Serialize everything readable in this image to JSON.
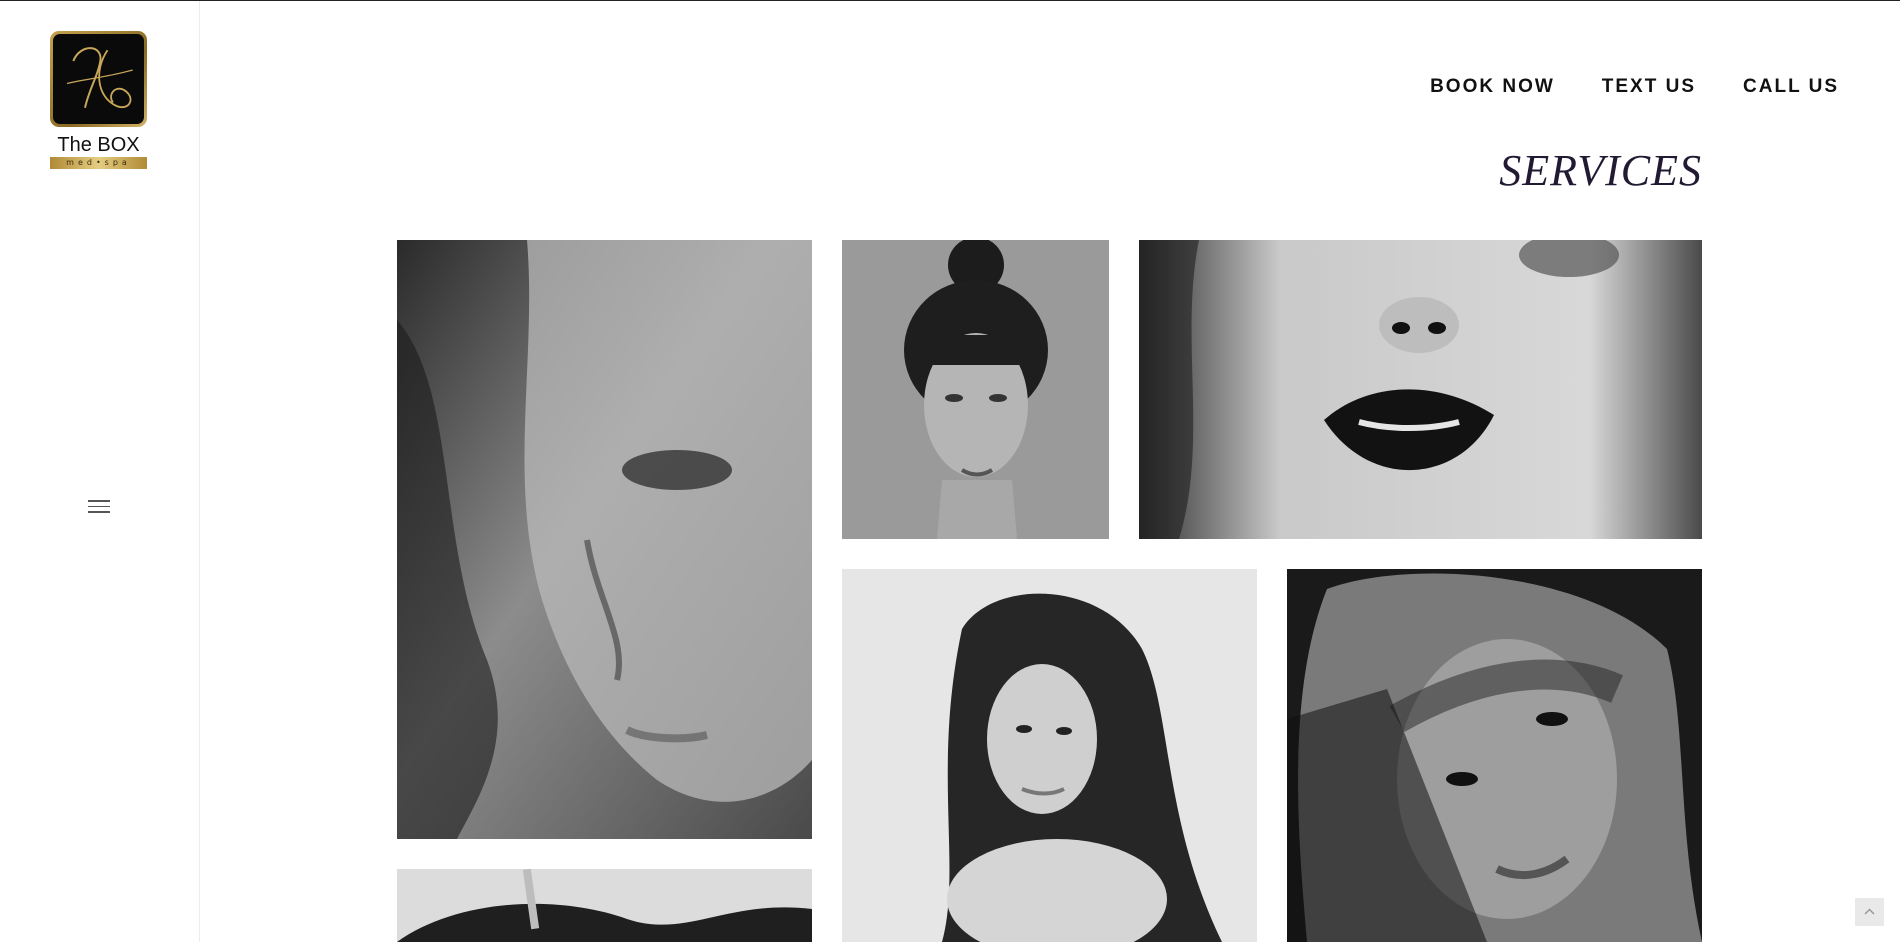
{
  "brand": {
    "name": "The BOX",
    "tagline": "med•spa",
    "accent_color": "#c6a24f"
  },
  "nav": {
    "items": [
      {
        "label": "BOOK NOW"
      },
      {
        "label": "TEXT US"
      },
      {
        "label": "CALL US"
      }
    ]
  },
  "page": {
    "title": "SERVICES"
  },
  "gallery": {
    "tiles": [
      {
        "icon": "portrait-photo"
      },
      {
        "icon": "portrait-photo"
      },
      {
        "icon": "portrait-photo"
      },
      {
        "icon": "portrait-photo"
      },
      {
        "icon": "portrait-photo"
      },
      {
        "icon": "portrait-photo"
      }
    ]
  },
  "icons": {
    "menu": "hamburger-icon",
    "scroll_top": "chevron-up-icon"
  }
}
